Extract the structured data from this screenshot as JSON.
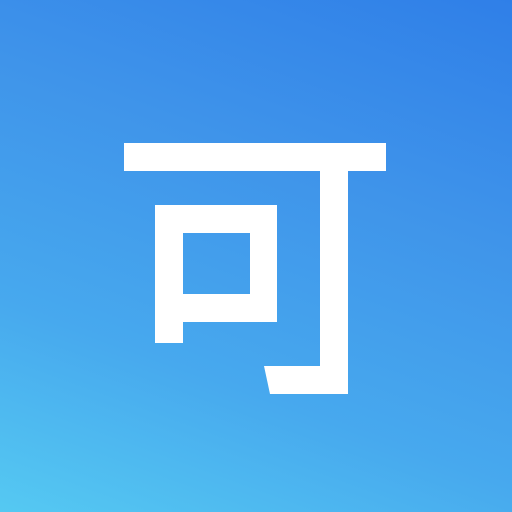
{
  "app_icon": {
    "character": "可",
    "colors": {
      "gradient_top_right": "#2f7fe8",
      "gradient_bottom_left": "#55c9f2",
      "glyph": "#ffffff"
    }
  }
}
